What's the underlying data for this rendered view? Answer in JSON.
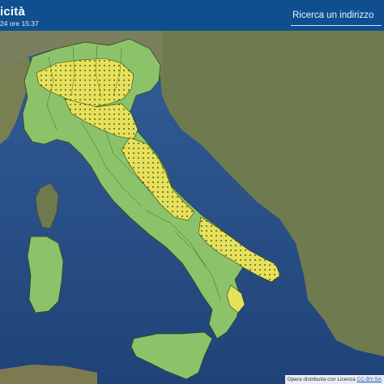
{
  "header": {
    "title": "icità",
    "subtitle": "24 ore 15:37",
    "search_placeholder": "Ricerca un indirizzo"
  },
  "map": {
    "legend_colors": {
      "green_zone": "#8cc36a",
      "yellow_zone": "#e6e15a",
      "sea": "#2d5fa6",
      "land": "#6f7c4e"
    }
  },
  "attribution": {
    "text": "Opera distribuita con Licenza",
    "license": "CC-BY-SA"
  }
}
